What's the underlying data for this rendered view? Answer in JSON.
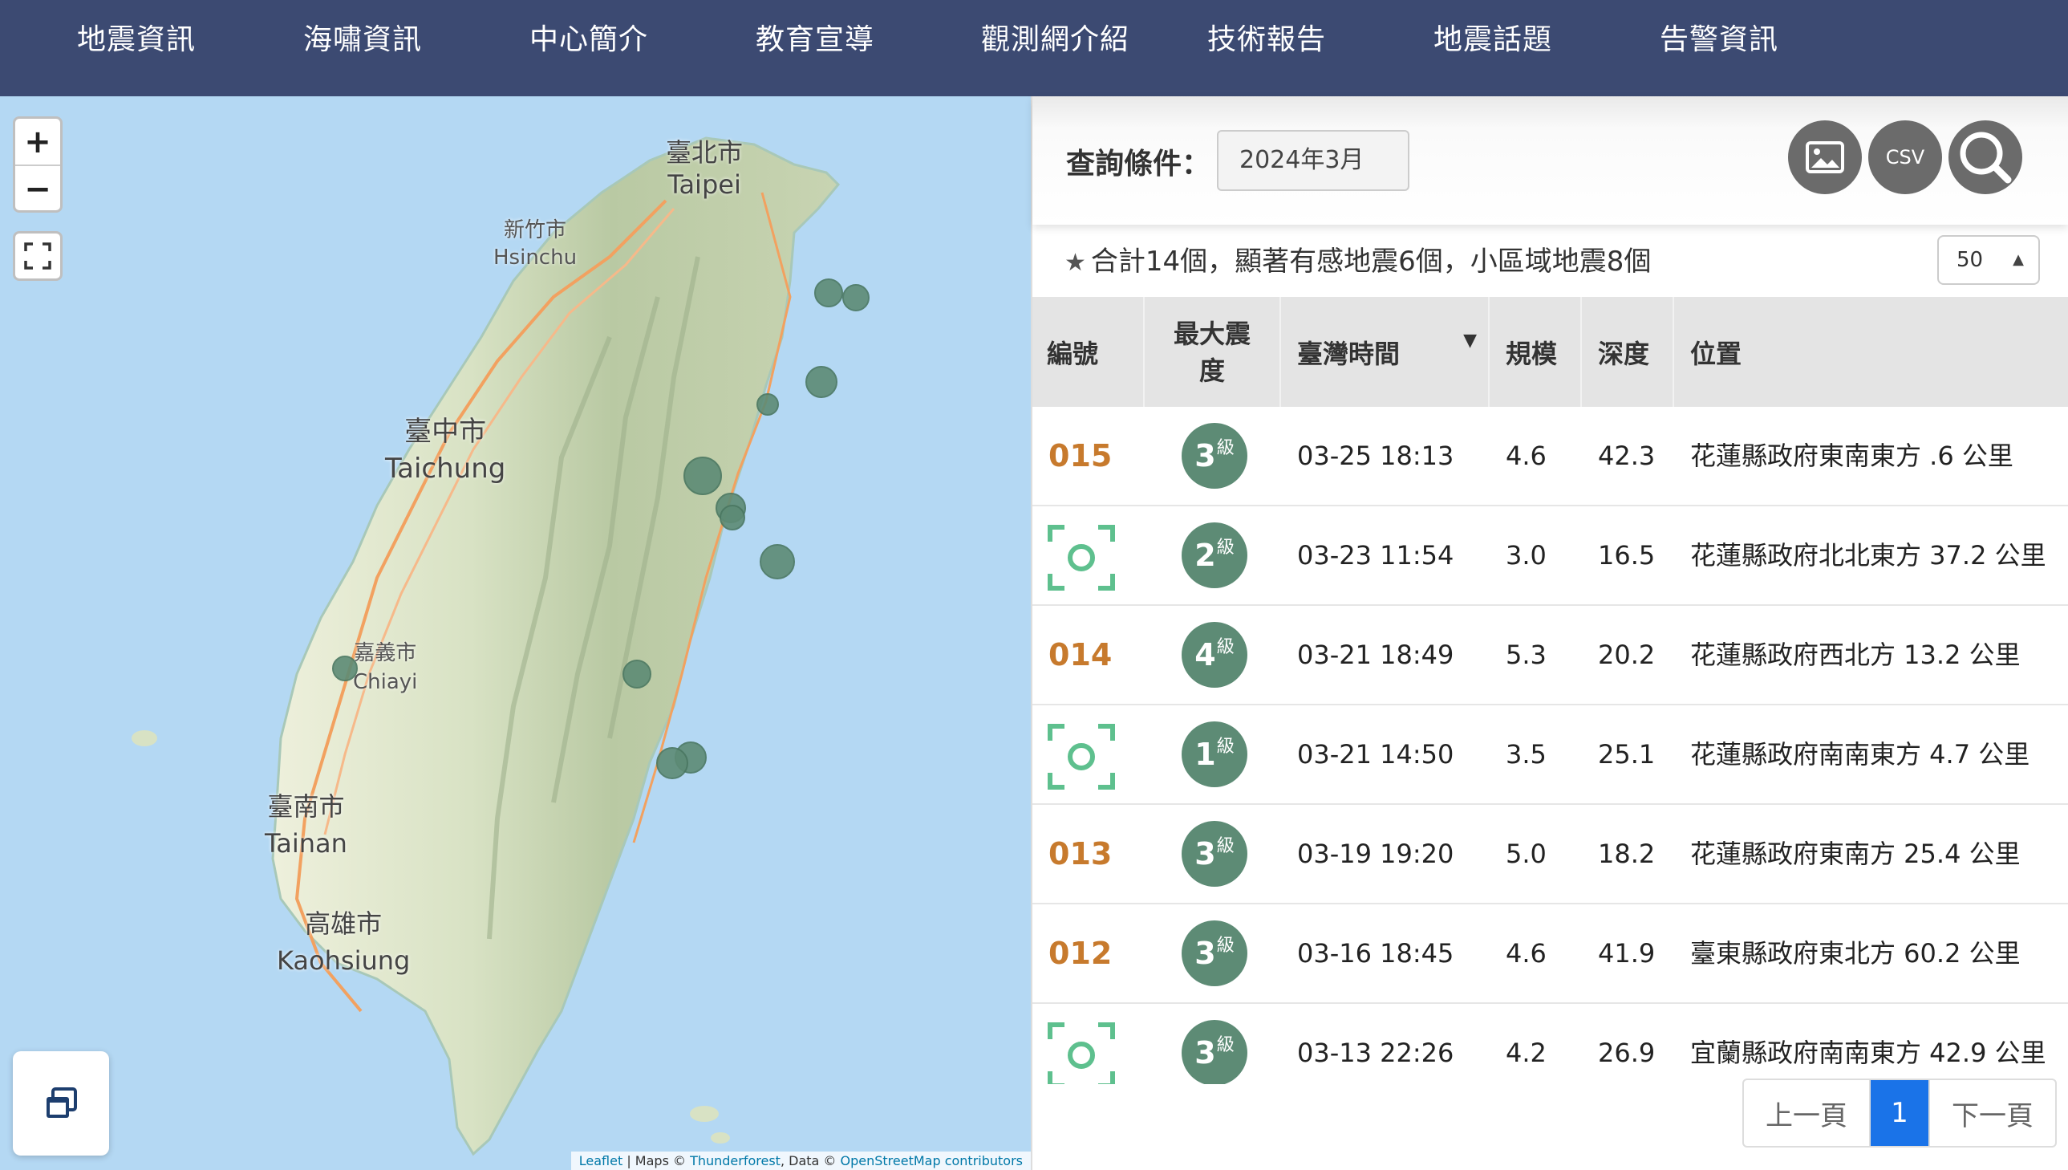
{
  "nav": [
    {
      "label": "地震資訊"
    },
    {
      "label": "海嘯資訊"
    },
    {
      "label": "中心簡介"
    },
    {
      "label": "教育宣導"
    },
    {
      "label": "觀測網介紹"
    },
    {
      "label": "技術報告"
    },
    {
      "label": "地震話題"
    },
    {
      "label": "告警資訊"
    }
  ],
  "map": {
    "zoom_in": "+",
    "zoom_out": "−",
    "cities": [
      {
        "zh": "臺北市",
        "en": "Taipei"
      },
      {
        "zh": "新竹市",
        "en": "Hsinchu"
      },
      {
        "zh": "臺中市",
        "en": "Taichung"
      },
      {
        "zh": "嘉義市",
        "en": "Chiayi"
      },
      {
        "zh": "臺南市",
        "en": "Tainan"
      },
      {
        "zh": "高雄市",
        "en": "Kaohsiung"
      }
    ],
    "attribution": {
      "leaflet": "Leaflet",
      "maps": " | Maps © ",
      "thunderforest": "Thunderforest",
      "data": ", Data © ",
      "osm": "OpenStreetMap contributors"
    },
    "marker_color": "#5d8b75"
  },
  "query": {
    "label": "查詢條件：",
    "value": "2024年3月",
    "image_button": "image-icon",
    "csv_button": "CSV",
    "search_button": "search-icon"
  },
  "summary": {
    "star": "★",
    "text": "合計14個，顯著有感地震6個，小區域地震8個"
  },
  "page_size": "50",
  "table": {
    "headers": {
      "id": "編號",
      "intensity": "最大震度",
      "time": "臺灣時間",
      "magnitude": "規模",
      "depth": "深度",
      "location": "位置"
    },
    "rows": [
      {
        "id": "015",
        "intensity": "3",
        "unit": "級",
        "time": "03-25 18:13",
        "magnitude": "4.6",
        "depth": "42.3",
        "location": "花蓮縣政府東南東方 .6 公里"
      },
      {
        "id": "",
        "intensity": "2",
        "unit": "級",
        "time": "03-23 11:54",
        "magnitude": "3.0",
        "depth": "16.5",
        "location": "花蓮縣政府北北東方 37.2 公里"
      },
      {
        "id": "014",
        "intensity": "4",
        "unit": "級",
        "time": "03-21 18:49",
        "magnitude": "5.3",
        "depth": "20.2",
        "location": "花蓮縣政府西北方 13.2 公里"
      },
      {
        "id": "",
        "intensity": "1",
        "unit": "級",
        "time": "03-21 14:50",
        "magnitude": "3.5",
        "depth": "25.1",
        "location": "花蓮縣政府南南東方 4.7 公里"
      },
      {
        "id": "013",
        "intensity": "3",
        "unit": "級",
        "time": "03-19 19:20",
        "magnitude": "5.0",
        "depth": "18.2",
        "location": "花蓮縣政府東南方 25.4 公里"
      },
      {
        "id": "012",
        "intensity": "3",
        "unit": "級",
        "time": "03-16 18:45",
        "magnitude": "4.6",
        "depth": "41.9",
        "location": "臺東縣政府東北方 60.2 公里"
      },
      {
        "id": "",
        "intensity": "3",
        "unit": "級",
        "time": "03-13 22:26",
        "magnitude": "4.2",
        "depth": "26.9",
        "location": "宜蘭縣政府南南東方 42.9 公里"
      }
    ]
  },
  "pager": {
    "prev": "上一頁",
    "current": "1",
    "next": "下一頁"
  }
}
